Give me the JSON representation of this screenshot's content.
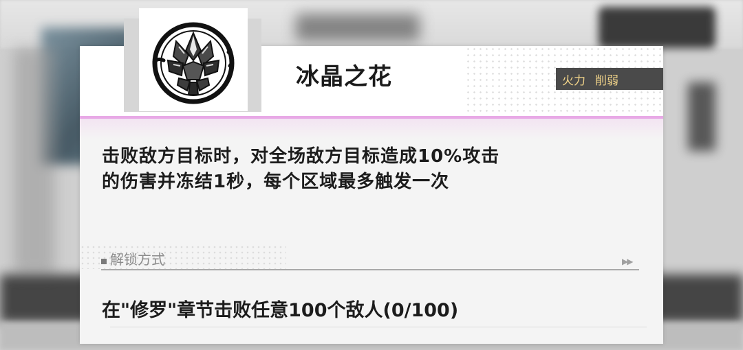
{
  "skill": {
    "title": "冰晶之花",
    "icon": "ice-crystal-flower-icon",
    "tags": [
      "火力",
      "削弱"
    ],
    "description_lines": [
      "击败敌方目标时，对全场敌方目标造成10%攻击",
      "的伤害并冻结1秒，每个区域最多触发一次"
    ]
  },
  "unlock": {
    "label": "解锁方式",
    "arrows": "▶▶",
    "condition": "在\"修罗\"章节击败任意100个敌人(0/100)"
  },
  "colors": {
    "accent_pink": "#e8a9e6",
    "tag_bg": "#4a4a4a",
    "tag_text": "#f3d58a"
  }
}
